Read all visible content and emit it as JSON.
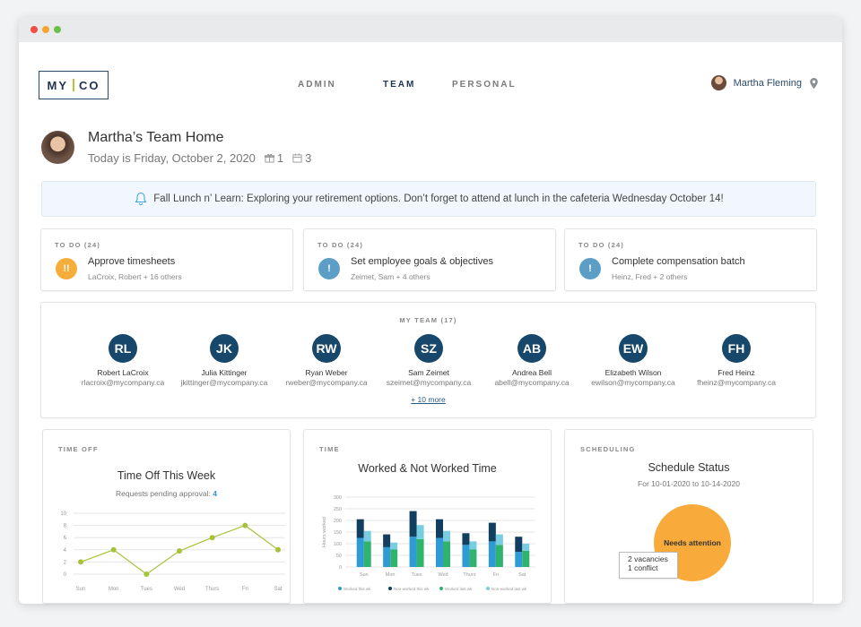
{
  "brand": {
    "left": "MY",
    "right": "CO"
  },
  "nav": [
    {
      "label": "ADMIN",
      "active": false
    },
    {
      "label": "TEAM",
      "active": true
    },
    {
      "label": "PERSONAL",
      "active": false
    }
  ],
  "user": {
    "name": "Martha Fleming"
  },
  "page": {
    "title": "Martha’s Team Home",
    "subtitle": "Today is Friday, October 2, 2020",
    "gift_count": "1",
    "calendar_count": "3"
  },
  "banner": {
    "text": "Fall Lunch n’ Learn: Exploring your retirement options. Don’t forget to attend at lunch in the cafeteria Wednesday October 14!"
  },
  "todos": [
    {
      "kicker": "TO DO (24)",
      "badge": "!!",
      "badge_color": "#f7ad3a",
      "title": "Approve timesheets",
      "meta": "LaCroix, Robert + 16 others"
    },
    {
      "kicker": "TO DO (24)",
      "badge": "!",
      "badge_color": "#5d9ec7",
      "title": "Set employee goals & objectives",
      "meta": "Zeimet, Sam + 4 others"
    },
    {
      "kicker": "TO DO (24)",
      "badge": "!",
      "badge_color": "#5d9ec7",
      "title": "Complete compensation batch",
      "meta": "Heinz, Fred + 2 others"
    }
  ],
  "team": {
    "kicker": "MY TEAM (17)",
    "more": "+ 10 more",
    "members": [
      {
        "initials": "RL",
        "name": "Robert LaCroix",
        "email": "rlacroix@mycompany.ca"
      },
      {
        "initials": "JK",
        "name": "Julia Kittinger",
        "email": "jkittinger@mycompany.ca"
      },
      {
        "initials": "RW",
        "name": "Ryan Weber",
        "email": "rweber@mycompany.ca"
      },
      {
        "initials": "SZ",
        "name": "Sam Zeimet",
        "email": "szeimet@mycompany.ca"
      },
      {
        "initials": "AB",
        "name": "Andrea Bell",
        "email": "abell@mycompany.ca"
      },
      {
        "initials": "EW",
        "name": "Elizabeth Wilson",
        "email": "ewilson@mycompany.ca"
      },
      {
        "initials": "FH",
        "name": "Fred Heinz",
        "email": "fheinz@mycompany.ca"
      }
    ]
  },
  "time_off": {
    "kicker": "TIME OFF",
    "title": "Time Off This Week",
    "pending_label": "Requests pending approval:",
    "pending_count": "4"
  },
  "time": {
    "kicker": "TIME",
    "title": "Worked & Not Worked Time"
  },
  "scheduling": {
    "kicker": "SCHEDULING",
    "title": "Schedule Status",
    "range": "For 10-01-2020 to 10-14-2020",
    "status": "Needs attention",
    "vacancies": "2 vacancies",
    "conflicts": "1 conflict"
  },
  "chart_data": [
    {
      "type": "line",
      "categories": [
        "Sun",
        "Mon",
        "Tues",
        "Wed",
        "Thurs",
        "Fri",
        "Sat"
      ],
      "values": [
        2,
        4,
        0,
        3.8,
        6,
        8,
        4
      ],
      "ylim": [
        0,
        10
      ],
      "yticks": [
        0,
        2,
        4,
        6,
        8,
        10
      ],
      "color": "#a6c23b"
    },
    {
      "type": "bar",
      "ylabel": "Hours worked",
      "categories": [
        "Sun",
        "Mon",
        "Tues",
        "Wed",
        "Thurs",
        "Fri",
        "Sat"
      ],
      "ylim": [
        0,
        300
      ],
      "yticks": [
        0,
        50,
        100,
        150,
        200,
        250,
        300
      ],
      "series": [
        {
          "name": "Worked this wk",
          "color": "#2e9bd5",
          "values": [
            125,
            85,
            130,
            125,
            95,
            110,
            65
          ]
        },
        {
          "name": "Non-worked this wk",
          "color": "#123e5f",
          "values": [
            80,
            55,
            110,
            80,
            50,
            80,
            65
          ]
        },
        {
          "name": "Worked last wk",
          "color": "#2fb36d",
          "values": [
            110,
            75,
            120,
            110,
            75,
            95,
            70
          ]
        },
        {
          "name": "Non-worked last wk",
          "color": "#79cde0",
          "values": [
            45,
            30,
            60,
            45,
            35,
            45,
            30
          ]
        }
      ]
    }
  ]
}
